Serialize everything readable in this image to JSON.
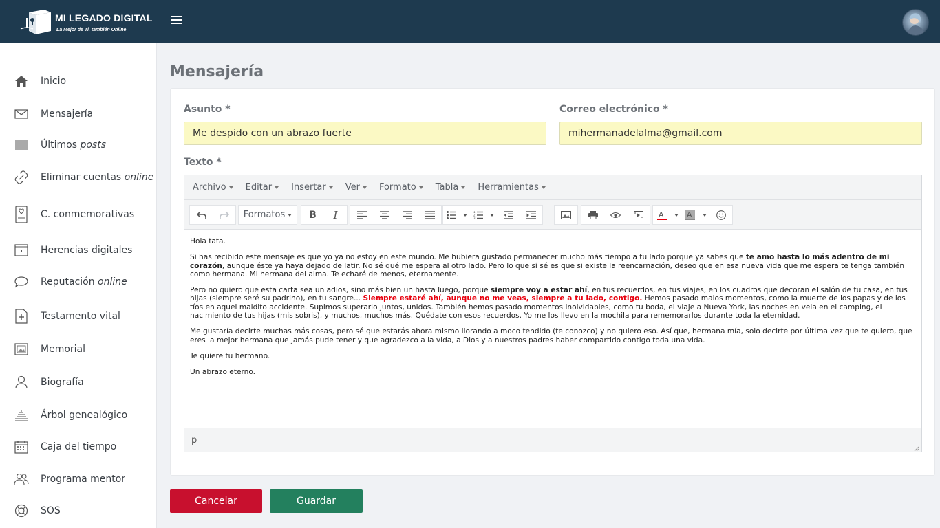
{
  "brand": {
    "title": "MI LEGADO DIGITAL",
    "tagline": "La Mejor de Ti, también Online"
  },
  "colors": {
    "topbar": "#1e3a4f",
    "cancel": "#c8102e",
    "save": "#23805e",
    "field_bg": "#fbf9c4"
  },
  "sidebar": {
    "items": [
      {
        "icon": "home-icon",
        "label": "Inicio",
        "emph": ""
      },
      {
        "icon": "envelope-icon",
        "label": "Mensajería",
        "emph": ""
      },
      {
        "icon": "newspaper-icon",
        "label": "Últimos ",
        "emph": "posts"
      },
      {
        "icon": "broken-link-icon",
        "label": "Eliminar cuentas ",
        "emph": "online"
      },
      {
        "icon": "memorial-card-icon",
        "label": "C. conmemorativas",
        "emph": ""
      },
      {
        "icon": "box-icon",
        "label": "Herencias digitales",
        "emph": ""
      },
      {
        "icon": "speech-bubble-icon",
        "label": "Reputación ",
        "emph": "online"
      },
      {
        "icon": "document-plus-icon",
        "label": "Testamento vital",
        "emph": ""
      },
      {
        "icon": "photo-frame-icon",
        "label": "Memorial",
        "emph": ""
      },
      {
        "icon": "user-icon",
        "label": "Biografía",
        "emph": ""
      },
      {
        "icon": "tree-icon",
        "label": "Árbol genealógico",
        "emph": ""
      },
      {
        "icon": "calendar-icon",
        "label": "Caja del tiempo",
        "emph": ""
      },
      {
        "icon": "users-icon",
        "label": "Programa mentor",
        "emph": ""
      },
      {
        "icon": "lifebuoy-icon",
        "label": "SOS",
        "emph": ""
      }
    ]
  },
  "page": {
    "title": "Mensajería"
  },
  "form": {
    "subject_label": "Asunto *",
    "subject_value": "Me despido con un abrazo fuerte",
    "email_label": "Correo electrónico *",
    "email_value": "mihermanadelalma@gmail.com",
    "text_label": "Texto *"
  },
  "editor": {
    "menus": [
      "Archivo",
      "Editar",
      "Insertar",
      "Ver",
      "Formato",
      "Tabla",
      "Herramientas"
    ],
    "formats_label": "Formatos",
    "status_path": "p",
    "paragraphs": {
      "p1": "Hola tata.",
      "p2a": "Si has recibido este mensaje es que yo ya no estoy en este mundo. Me hubiera gustado permanecer mucho más tiempo a tu lado porque ya sabes que ",
      "p2b": "te amo hasta lo más adentro de mi corazón",
      "p2c": ", aunque éste ya haya dejado de latir. No sé qué me espera al otro lado. Pero lo que sí sé es que si existe la reencarnación, deseo que en esa nueva vida que me espera te tenga también como hermana. Mi hermana del alma. Te echaré de menos, eternamente.",
      "p3a": "Pero no quiero que esta carta sea un adios, sino más bien un hasta luego, porque ",
      "p3b": "siempre voy a estar ahí",
      "p3c": ", en tus recuerdos, en tus viajes, en los cuadros que decoran el salón de tu casa, en tus hijas (siempre seré su padrino), en tu sangre... ",
      "p3d": "Siempre estaré ahí, aunque no me veas, siempre a tu lado, contigo.",
      "p3e": " Hemos pasado malos momentos, como la muerte de los papas y de los tíos en aquel maldito accidente. Supimos superarlo juntos, unidos. También hemos pasado momentos inolvidables, como tu boda, el viaje a Nueva York, las noches en vela en el camping, el nacimiento de tus hijas (mis sobris), y muchos, muchos más. Quédate con esos recuerdos. Yo me los llevo en la mochila para rememorarlos durante toda la eternidad.",
      "p4": "Me gustaría decirte muchas más cosas, pero sé que estarás ahora mismo llorando a moco tendido (te conozco) y no quiero eso. Así que, hermana mía, solo decirte por última vez que te quiero, que eres la mejor hermana que jamás pude tener y que agradezco a la vida, a Dios y a nuestros padres haber compartido contigo toda una vida.",
      "p5": "Te quiere tu hermano.",
      "p6": "Un abrazo eterno."
    }
  },
  "buttons": {
    "cancel": "Cancelar",
    "save": "Guardar"
  }
}
